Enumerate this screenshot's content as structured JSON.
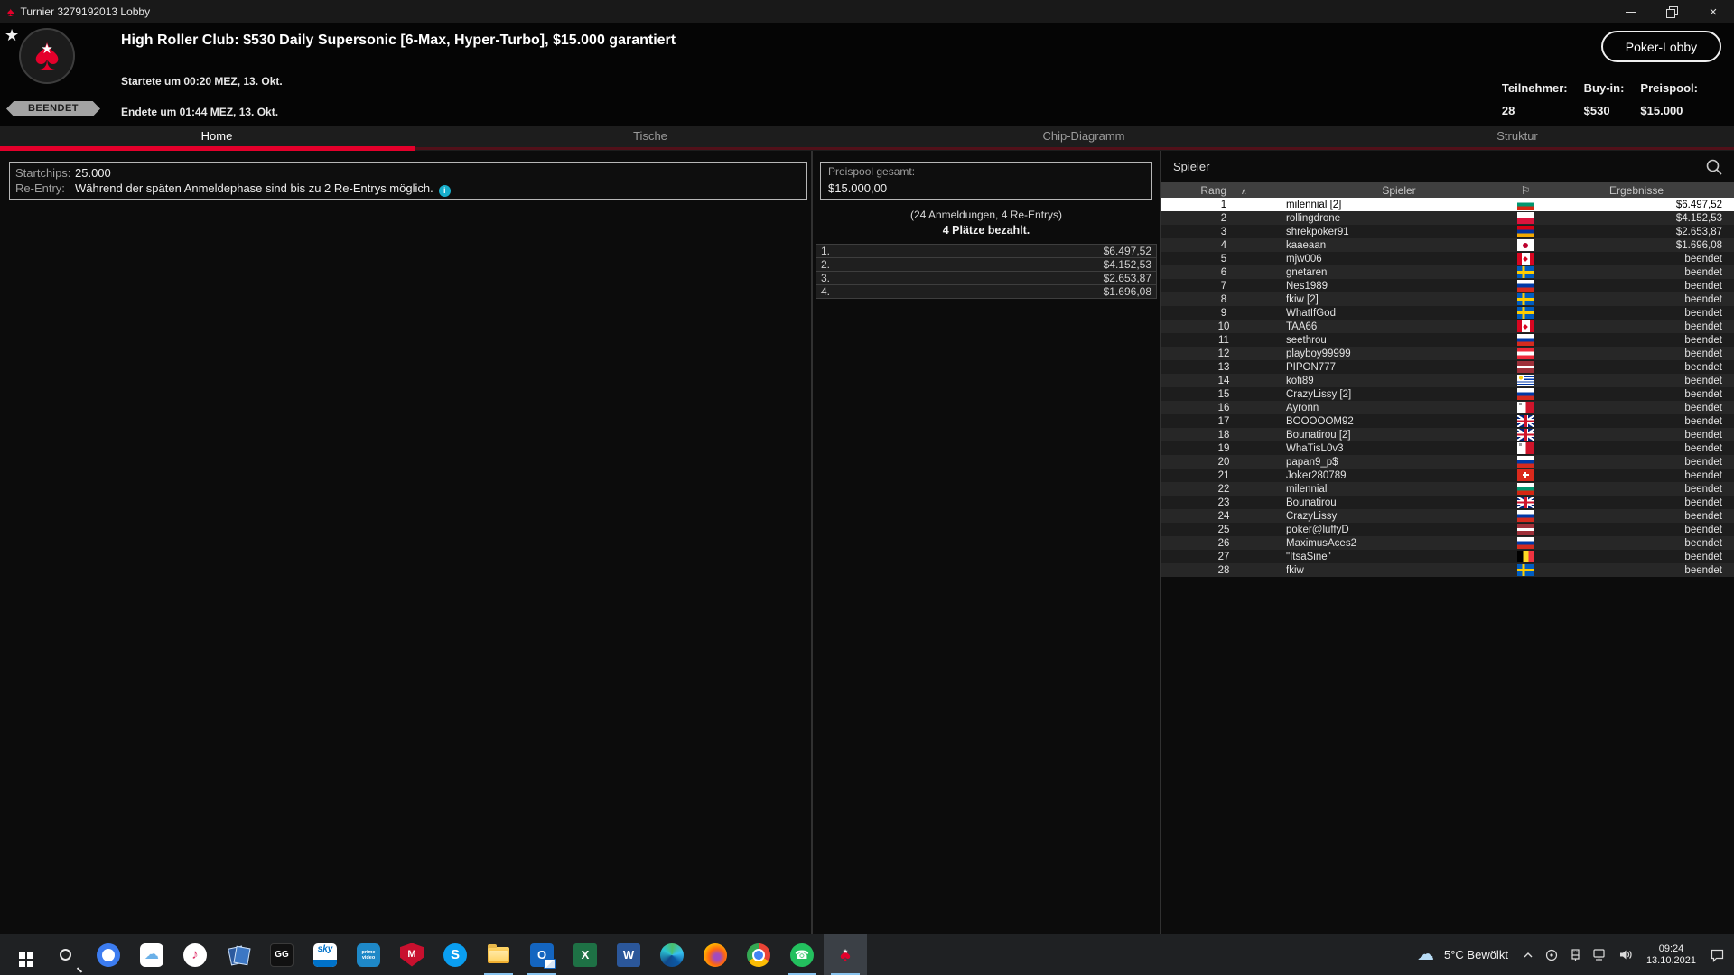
{
  "window": {
    "title": "Turnier 3279192013 Lobby"
  },
  "icons": {
    "spade": "♠",
    "star": "★",
    "flag_column": "⚐",
    "sort_asc": "∧",
    "info": "i",
    "minimize": "–",
    "close": "×",
    "cloud": "☁"
  },
  "header": {
    "badge": "BEENDET",
    "title": "High Roller Club: $530 Daily Supersonic [6-Max, Hyper-Turbo], $15.000 garantiert",
    "started": "Startete um 00:20 MEZ, 13. Okt.",
    "ended": "Endete um 01:44 MEZ, 13. Okt.",
    "lobby_button": "Poker-Lobby",
    "stats": [
      {
        "label": "Teilnehmer:",
        "value": "28"
      },
      {
        "label": "Buy-in:",
        "value": "$530"
      },
      {
        "label": "Preispool:",
        "value": "$15.000"
      }
    ]
  },
  "tabs": [
    {
      "label": "Home",
      "active": true
    },
    {
      "label": "Tische",
      "active": false
    },
    {
      "label": "Chip-Diagramm",
      "active": false
    },
    {
      "label": "Struktur",
      "active": false
    }
  ],
  "info_panel": {
    "rows": [
      {
        "label": "Startchips:",
        "value": "25.000",
        "info": false
      },
      {
        "label": "Re-Entry:",
        "value": "Während der späten Anmeldephase sind bis zu 2 Re-Entrys möglich.",
        "info": true
      }
    ]
  },
  "prize_panel": {
    "total_label": "Preispool gesamt:",
    "total_value": "$15.000,00",
    "registrations": "(24 Anmeldungen, 4 Re-Entrys)",
    "places_paid": "4 Plätze bezahlt.",
    "prizes": [
      {
        "place": "1.",
        "amount": "$6.497,52"
      },
      {
        "place": "2.",
        "amount": "$4.152,53"
      },
      {
        "place": "3.",
        "amount": "$2.653,87"
      },
      {
        "place": "4.",
        "amount": "$1.696,08"
      }
    ]
  },
  "players_panel": {
    "title": "Spieler",
    "columns": [
      "Rang",
      "Spieler",
      "Ergebnisse"
    ],
    "rows": [
      {
        "rank": "1",
        "name": "milennial [2]",
        "flag": "bg",
        "result": "$6.497,52",
        "selected": true
      },
      {
        "rank": "2",
        "name": "rollingdrone",
        "flag": "pl",
        "result": "$4.152,53"
      },
      {
        "rank": "3",
        "name": "shrekpoker91",
        "flag": "am",
        "result": "$2.653,87"
      },
      {
        "rank": "4",
        "name": "kaaeaan",
        "flag": "jp",
        "result": "$1.696,08"
      },
      {
        "rank": "5",
        "name": "mjw006",
        "flag": "ca",
        "result": "beendet"
      },
      {
        "rank": "6",
        "name": "gnetaren",
        "flag": "se",
        "result": "beendet"
      },
      {
        "rank": "7",
        "name": "Nes1989",
        "flag": "ru",
        "result": "beendet"
      },
      {
        "rank": "8",
        "name": "fkiw [2]",
        "flag": "se",
        "result": "beendet"
      },
      {
        "rank": "9",
        "name": "WhatIfGod",
        "flag": "se",
        "result": "beendet"
      },
      {
        "rank": "10",
        "name": "TAA66",
        "flag": "ca",
        "result": "beendet"
      },
      {
        "rank": "11",
        "name": "seethrou",
        "flag": "ru",
        "result": "beendet"
      },
      {
        "rank": "12",
        "name": "playboy99999",
        "flag": "at",
        "result": "beendet"
      },
      {
        "rank": "13",
        "name": "PIPON777",
        "flag": "lv",
        "result": "beendet"
      },
      {
        "rank": "14",
        "name": "kofi89",
        "flag": "uy",
        "result": "beendet"
      },
      {
        "rank": "15",
        "name": "CrazyLissy [2]",
        "flag": "ru",
        "result": "beendet"
      },
      {
        "rank": "16",
        "name": "Ayronn",
        "flag": "mt",
        "result": "beendet"
      },
      {
        "rank": "17",
        "name": "BOOOOOM92",
        "flag": "gb",
        "result": "beendet"
      },
      {
        "rank": "18",
        "name": "Bounatirou [2]",
        "flag": "gb",
        "result": "beendet"
      },
      {
        "rank": "19",
        "name": "WhaTisL0v3",
        "flag": "mt",
        "result": "beendet"
      },
      {
        "rank": "20",
        "name": "papan9_p$",
        "flag": "ru",
        "result": "beendet"
      },
      {
        "rank": "21",
        "name": "Joker280789",
        "flag": "ch",
        "result": "beendet"
      },
      {
        "rank": "22",
        "name": "milennial",
        "flag": "bg",
        "result": "beendet"
      },
      {
        "rank": "23",
        "name": "Bounatirou",
        "flag": "gb",
        "result": "beendet"
      },
      {
        "rank": "24",
        "name": "CrazyLissy",
        "flag": "ru",
        "result": "beendet"
      },
      {
        "rank": "25",
        "name": "poker@luffyD",
        "flag": "lv",
        "result": "beendet"
      },
      {
        "rank": "26",
        "name": "MaximusAces2",
        "flag": "ru",
        "result": "beendet"
      },
      {
        "rank": "27",
        "name": "\"ItsaSine\"",
        "flag": "be",
        "result": "beendet"
      },
      {
        "rank": "28",
        "name": "fkiw",
        "flag": "se",
        "result": "beendet"
      }
    ]
  },
  "taskbar": {
    "weather": "5°C Bewölkt",
    "time": "09:24",
    "date": "13.10.2021",
    "apps": [
      {
        "id": "start",
        "name": "start",
        "glyph": ""
      },
      {
        "id": "searchtb",
        "name": "search",
        "glyph": ""
      },
      {
        "id": "signal",
        "name": "signal",
        "glyph": ""
      },
      {
        "id": "icloud",
        "name": "icloud",
        "glyph": "☁"
      },
      {
        "id": "itunes",
        "name": "itunes",
        "glyph": "♪"
      },
      {
        "id": "cards",
        "name": "poker-cards",
        "glyph": ""
      },
      {
        "id": "gg",
        "name": "ggpoker",
        "glyph": "GG"
      },
      {
        "id": "sky",
        "name": "sky",
        "glyph": "sky"
      },
      {
        "id": "prime",
        "name": "prime-video",
        "glyph": "prime video"
      },
      {
        "id": "mcafee",
        "name": "mcafee",
        "glyph": "M"
      },
      {
        "id": "skype",
        "name": "skype",
        "glyph": "S"
      },
      {
        "id": "explorer",
        "name": "file-explorer",
        "glyph": "",
        "running": true
      },
      {
        "id": "outlook",
        "name": "outlook",
        "glyph": "O",
        "running": true
      },
      {
        "id": "excel",
        "name": "excel",
        "glyph": "X"
      },
      {
        "id": "word",
        "name": "word",
        "glyph": "W"
      },
      {
        "id": "edge",
        "name": "edge",
        "glyph": ""
      },
      {
        "id": "firefox",
        "name": "firefox",
        "glyph": ""
      },
      {
        "id": "chrome",
        "name": "chrome",
        "glyph": ""
      },
      {
        "id": "whatsapp",
        "name": "whatsapp",
        "glyph": "☎",
        "running": true
      },
      {
        "id": "pokerstars",
        "name": "pokerstars",
        "glyph": "♠",
        "running": true,
        "active": true
      }
    ]
  }
}
